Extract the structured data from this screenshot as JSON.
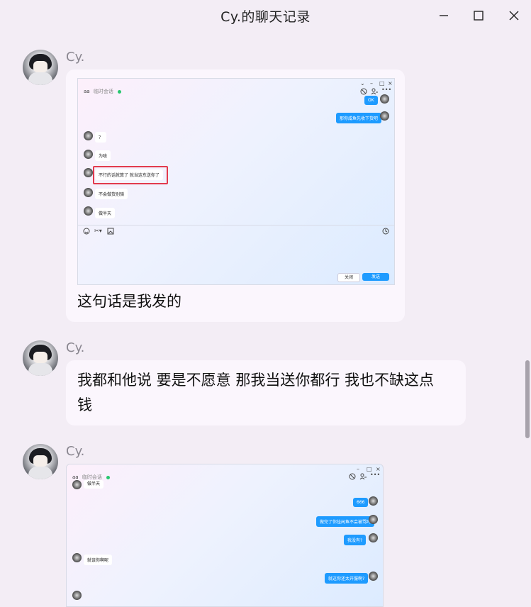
{
  "window": {
    "title": "Cy.的聊天记录",
    "controls": {
      "minimize": "minimize-icon",
      "maximize": "maximize-icon",
      "close": "close-icon"
    }
  },
  "messages": [
    {
      "sender": "Cy.",
      "type": "image+text",
      "image": {
        "header_name": "aa",
        "header_status": "临时会话",
        "header_icons": [
          "block-icon",
          "add-user-icon",
          "more-icon"
        ],
        "titlebar_glyphs": [
          "⌄",
          "–",
          "□",
          "×"
        ],
        "out_messages": [
          "OK",
          "那你咸鱼先收下货吧"
        ],
        "in_messages": [
          "？",
          "为啥",
          "不行的话就算了 就当这东送你了",
          "不会做货别骑",
          "做半天"
        ],
        "toolbar_icons": [
          "emoji-icon",
          "scissors-icon",
          "image-icon",
          "history-icon"
        ],
        "close_button": "关闭",
        "send_button": "发送"
      },
      "text": "这句话是我发的"
    },
    {
      "sender": "Cy.",
      "type": "text",
      "text_lines": [
        "我都和他说 要是不愿意 那我当送你都行 我也不缺这点",
        "钱"
      ]
    },
    {
      "sender": "Cy.",
      "type": "image",
      "image": {
        "header_name": "aa",
        "header_status": "临时会话",
        "titlebar_glyphs": [
          "–",
          "□",
          "×"
        ],
        "partial_top": "做半天",
        "out_messages": [
          "666",
          "做完了你挂闲鱼不会被骂吗",
          "我没有?",
          "就这你还太开服啊?"
        ],
        "in_messages": [
          "就该你啊呢"
        ]
      }
    }
  ]
}
